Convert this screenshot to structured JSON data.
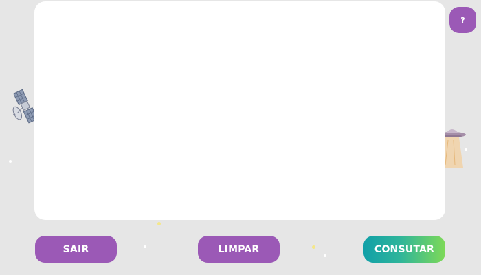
{
  "help": {
    "label": "?"
  },
  "buttons": {
    "exit_label": "SAIR",
    "clear_label": "LIMPAR",
    "query_label": "CONSUTAR"
  },
  "icons": {
    "satellite": "satellite-icon",
    "ufo": "ufo-icon",
    "stars": "star-icon"
  },
  "colors": {
    "background": "#e6e6e6",
    "panel": "#ffffff",
    "primary_purple": "#9b59b6",
    "gradient_start": "#11a0a8",
    "gradient_end": "#7ed957"
  }
}
